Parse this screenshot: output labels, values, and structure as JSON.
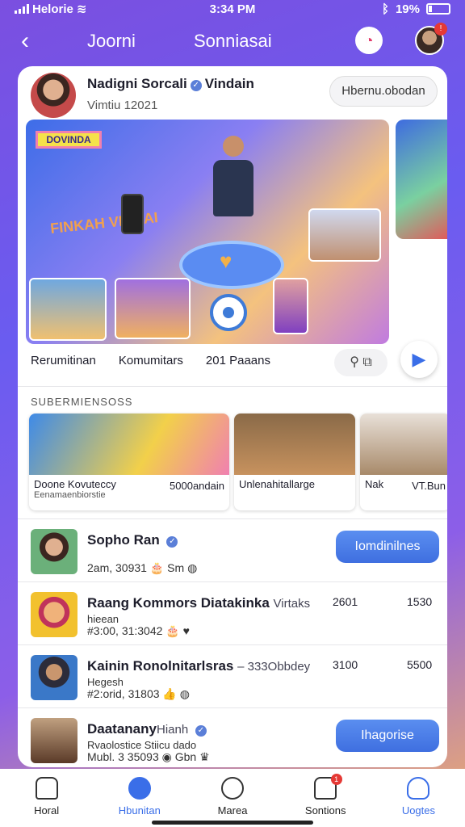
{
  "status": {
    "carrier": "Helorie",
    "time": "3:34 PM",
    "battery": "19%"
  },
  "header": {
    "title_1": "Joorni",
    "title_2": "Sonniasai"
  },
  "post": {
    "name": "Nadigni Sorcali",
    "name_suffix": "Vindain",
    "date": "Vimtiu 12021",
    "follow_label": "Hbernu.obodan",
    "hero_badge": "DOVINDA",
    "hero_text": "FINKAH VIHUAI",
    "stats": [
      "Rerumitinan",
      "Komumitars",
      "201 Paaans"
    ]
  },
  "section": {
    "label": "SUBERMIENSOSS"
  },
  "thumbs": [
    {
      "caption": "Doone Kovuteccy",
      "sub": "Eenamaenbiorstie",
      "value": "5000andain"
    },
    {
      "caption": "Unlenahitallarge"
    },
    {
      "caption": "Nak",
      "value": "VT.Bun"
    }
  ],
  "list": [
    {
      "title": "Sopho Ran",
      "meta": "2am, 30931",
      "meta_2": "Sm",
      "button": "Iomdinilnes"
    },
    {
      "title": "Raang Kommors Diatakinka",
      "extra": "Virtaks",
      "desc": "hieean",
      "meta": "#3:00, 31:3042",
      "col1": "2601",
      "col2": "1530"
    },
    {
      "title": "Kainin Ronolnitarlsras",
      "extra": "– 333Obbdey",
      "desc": "Hegesh",
      "meta": "#2:orid, 31803",
      "col1": "3100",
      "col2": "5500"
    },
    {
      "title": "Daatanany",
      "extra": "Hianh",
      "desc": "Rvaolostice Stiicu dado",
      "meta": "Mubl. 3 35093",
      "meta_2": "Gbn",
      "button": "Ihagorise"
    }
  ],
  "nav": [
    {
      "label": "Horal"
    },
    {
      "label": "Hbunitan"
    },
    {
      "label": "Marea"
    },
    {
      "label": "Sontions"
    },
    {
      "label": "Uogtes"
    }
  ],
  "colors": {
    "accent": "#3a6ee8",
    "badge": "#e53935",
    "bg_top": "#7b4fe0",
    "bg_bottom": "#f0b06a"
  }
}
